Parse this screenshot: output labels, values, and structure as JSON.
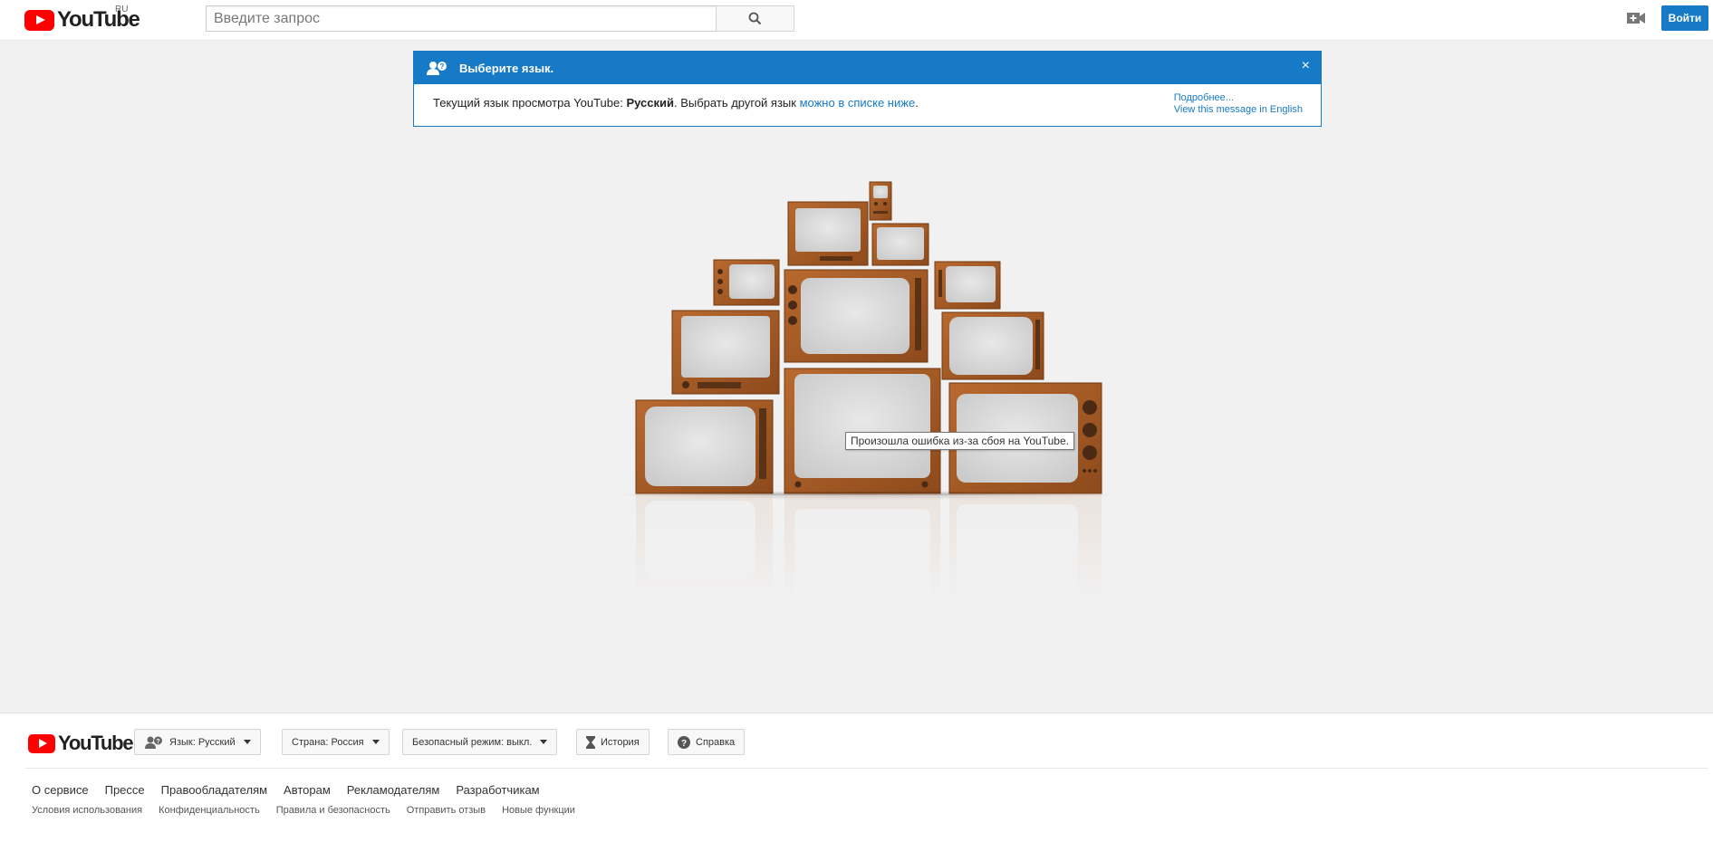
{
  "masthead": {
    "logo_text": "YouTube",
    "country_code": "RU",
    "search_placeholder": "Введите запрос",
    "signin_label": "Войти"
  },
  "alert": {
    "title": "Выберите язык.",
    "close": "×",
    "body_prefix": "Текущий язык просмотра YouTube: ",
    "current_language": "Русский",
    "body_middle": ". Выбрать другой язык ",
    "body_link": "можно в списке ниже",
    "body_suffix": ".",
    "more_link": "Подробнее...",
    "english_link": "View this message in English"
  },
  "error": {
    "tooltip": "Произошла ошибка из-за сбоя на YouTube."
  },
  "footer": {
    "logo_text": "YouTube",
    "language_button": "Язык: Русский",
    "country_button": "Страна: Россия",
    "safety_button": "Безопасный режим: выкл.",
    "history_button": "История",
    "help_button": "Справка",
    "primary_links": [
      "О сервисе",
      "Прессе",
      "Правообладателям",
      "Авторам",
      "Рекламодателям",
      "Разработчикам"
    ],
    "secondary_links": [
      "Условия использования",
      "Конфиденциальность",
      "Правила и безопасность",
      "Отправить отзыв",
      "Новые функции"
    ]
  },
  "colors": {
    "brand_red": "#ff0000",
    "accent_blue": "#167ac6",
    "tv_wood": "#a65a26",
    "screen_gray": "#dcdcdc"
  }
}
